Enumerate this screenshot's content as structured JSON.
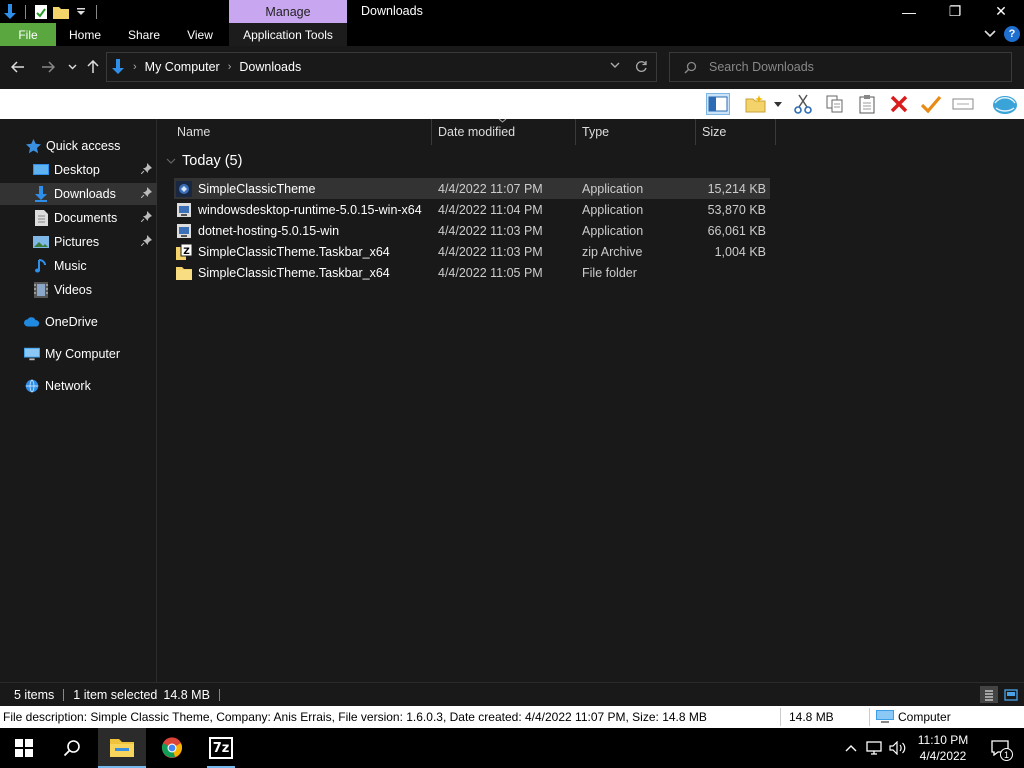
{
  "window": {
    "title": "Downloads",
    "contextual_tab_group": "Manage",
    "minimize_glyph": "—",
    "maximize_glyph": "❐",
    "close_glyph": "✕"
  },
  "ribbon": {
    "tabs": [
      "File",
      "Home",
      "Share",
      "View",
      "Application Tools"
    ],
    "file_tab_color": "#5aa63f",
    "manage_color": "#c9a6f0",
    "help_glyph": "?"
  },
  "address": {
    "breadcrumbs": [
      "My Computer",
      "Downloads"
    ],
    "search_placeholder": "Search Downloads"
  },
  "navpane": {
    "items": [
      {
        "label": "Quick access",
        "icon": "star-icon",
        "pinned": false,
        "selected": false
      },
      {
        "label": "Desktop",
        "icon": "desktop-icon",
        "pinned": true,
        "selected": false
      },
      {
        "label": "Downloads",
        "icon": "download-arrow-icon",
        "pinned": true,
        "selected": true
      },
      {
        "label": "Documents",
        "icon": "documents-icon",
        "pinned": true,
        "selected": false
      },
      {
        "label": "Pictures",
        "icon": "pictures-icon",
        "pinned": true,
        "selected": false
      },
      {
        "label": "Music",
        "icon": "music-note-icon",
        "pinned": false,
        "selected": false
      },
      {
        "label": "Videos",
        "icon": "videos-icon",
        "pinned": false,
        "selected": false
      },
      {
        "label": "OneDrive",
        "icon": "onedrive-cloud-icon",
        "pinned": false,
        "selected": false
      },
      {
        "label": "My Computer",
        "icon": "computer-icon",
        "pinned": false,
        "selected": false
      },
      {
        "label": "Network",
        "icon": "network-icon",
        "pinned": false,
        "selected": false
      }
    ]
  },
  "columns": [
    "Name",
    "Date modified",
    "Type",
    "Size"
  ],
  "group_header": "Today (5)",
  "files": [
    {
      "name": "SimpleClassicTheme",
      "date": "4/4/2022 11:07 PM",
      "type": "Application",
      "size": "15,214 KB",
      "icon": "app-icon",
      "selected": true
    },
    {
      "name": "windowsdesktop-runtime-5.0.15-win-x64",
      "date": "4/4/2022 11:04 PM",
      "type": "Application",
      "size": "53,870 KB",
      "icon": "installer-icon",
      "selected": false
    },
    {
      "name": "dotnet-hosting-5.0.15-win",
      "date": "4/4/2022 11:03 PM",
      "type": "Application",
      "size": "66,061 KB",
      "icon": "installer-icon",
      "selected": false
    },
    {
      "name": "SimpleClassicTheme.Taskbar_x64",
      "date": "4/4/2022 11:03 PM",
      "type": "zip Archive",
      "size": "1,004 KB",
      "icon": "zip-archive-icon",
      "selected": false
    },
    {
      "name": "SimpleClassicTheme.Taskbar_x64",
      "date": "4/4/2022 11:05 PM",
      "type": "File folder",
      "size": "",
      "icon": "folder-icon",
      "selected": false
    }
  ],
  "status": {
    "item_count": "5 items",
    "selection": "1 item selected",
    "selection_size": "14.8 MB"
  },
  "infobar": {
    "description": "File description: Simple Classic Theme, Company: Anis Errais, File version: 1.6.0.3, Date created: 4/4/2022 11:07 PM, Size: 14.8 MB",
    "size": "14.8 MB",
    "zone": "Computer"
  },
  "taskbar": {
    "time": "11:10 PM",
    "date": "4/4/2022",
    "notification_count": "1",
    "apps": [
      "start-icon",
      "search-icon",
      "file-explorer-icon",
      "chrome-icon",
      "7zip-icon"
    ],
    "7zip_label": "7z"
  }
}
